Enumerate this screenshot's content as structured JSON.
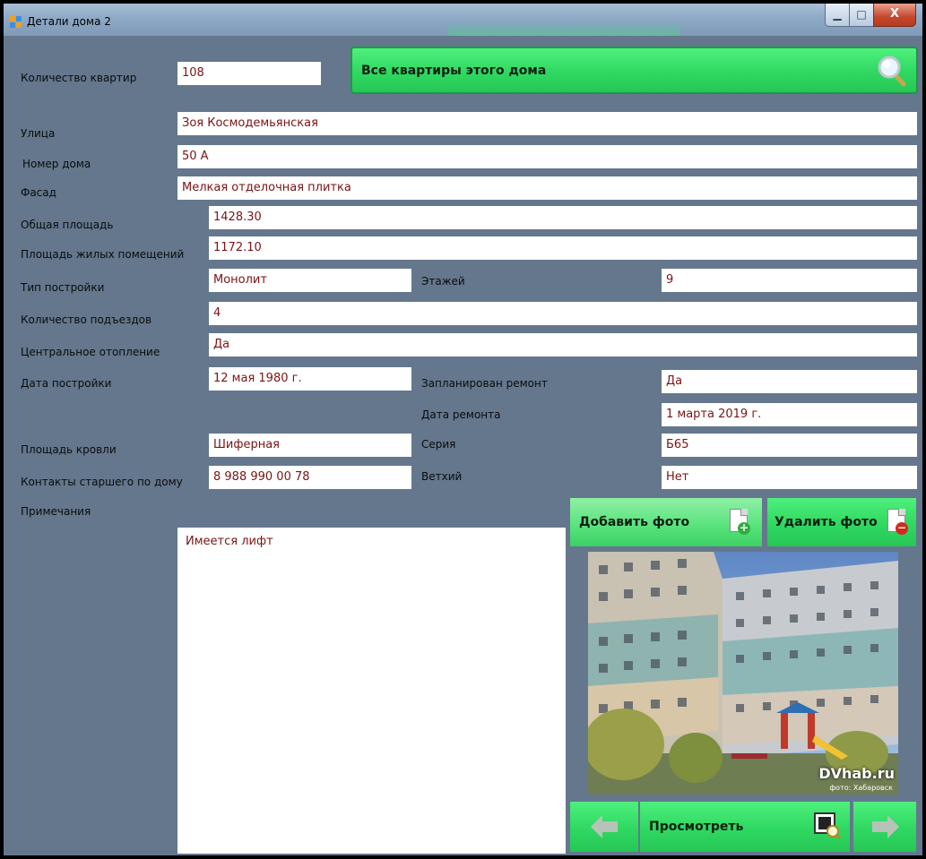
{
  "window": {
    "title": "Детали дома 2"
  },
  "fields": {
    "apartments_count": {
      "label": "Количество квартир",
      "value": "108"
    },
    "street": {
      "label": "Улица",
      "value": "Зоя Космодемьянская"
    },
    "house_number": {
      "label": "Номер дома",
      "value": "50 А"
    },
    "facade": {
      "label": "Фасад",
      "value": "Мелкая отделочная плитка"
    },
    "total_area": {
      "label": "Общая площадь",
      "value": "1428.30"
    },
    "living_area": {
      "label": "Площадь жилых помещений",
      "value": "1172.10"
    },
    "building_type": {
      "label": "Тип постройки",
      "value": "Монолит"
    },
    "floors": {
      "label": "Этажей",
      "value": "9"
    },
    "entrances": {
      "label": "Количество подъездов",
      "value": "4"
    },
    "central_heating": {
      "label": "Центральное отопление",
      "value": "Да"
    },
    "build_date": {
      "label": "Дата постройки",
      "value": "12 мая 1980 г."
    },
    "repair_planned": {
      "label": "Запланирован ремонт",
      "value": "Да"
    },
    "repair_date": {
      "label": "Дата ремонта",
      "value": "1 марта 2019 г."
    },
    "roof_area": {
      "label": "Площадь кровли",
      "value": "Шиферная"
    },
    "series": {
      "label": "Серия",
      "value": "Б65"
    },
    "senior_contact": {
      "label": "Контакты старшего по дому",
      "value": "8 988 990 00 78"
    },
    "dilapidated": {
      "label": "Ветхий",
      "value": "Нет"
    },
    "notes": {
      "label": "Примечания",
      "value": "Имеется лифт"
    }
  },
  "buttons": {
    "all_apartments": "Все квартиры этого дома",
    "add_photo": "Добавить фото",
    "delete_photo": "Удалить фото",
    "view": "Просмотреть"
  },
  "photo": {
    "watermark": "DVhab.ru",
    "watermark_sub": "фото: Хабаровск"
  },
  "colors": {
    "background": "#64778d",
    "button_green": "#2fd861",
    "value_text": "#7a1414"
  },
  "icons": [
    "window-icon",
    "minimize-icon",
    "maximize-icon",
    "close-icon",
    "search-magnifier-icon",
    "add-document-icon",
    "delete-document-icon",
    "arrow-left-icon",
    "arrow-right-icon",
    "preview-icon"
  ]
}
